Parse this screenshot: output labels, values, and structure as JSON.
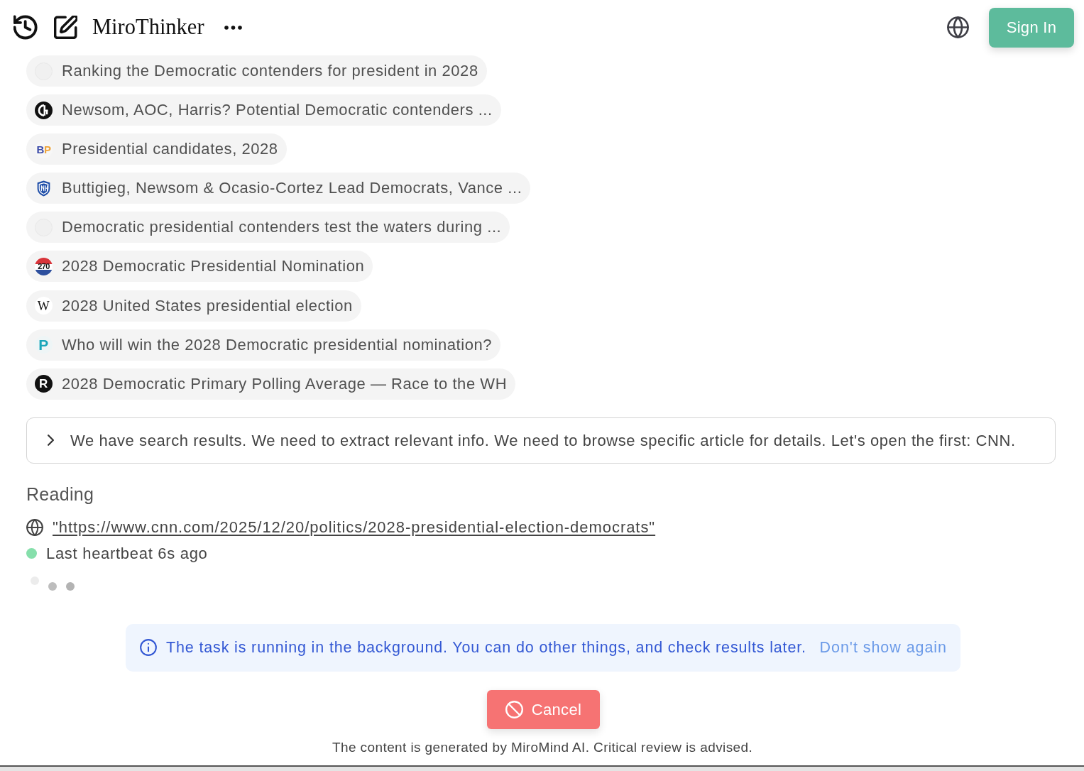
{
  "header": {
    "title": "MiroThinker",
    "sign_in": "Sign In"
  },
  "sources": [
    {
      "title": "Ranking the Democratic contenders for president in 2028",
      "favicon": {
        "kind": "blank"
      }
    },
    {
      "title": "Newsom, AOC, Harris? Potential Democratic contenders ...",
      "favicon": {
        "kind": "g"
      }
    },
    {
      "title": "Presidential candidates, 2028",
      "favicon": {
        "kind": "pair",
        "text": "BP"
      }
    },
    {
      "title": "Buttigieg, Newsom & Ocasio-Cortez Lead Democrats, Vance ...",
      "favicon": {
        "kind": "shield"
      }
    },
    {
      "title": "Democratic presidential contenders test the waters during ...",
      "favicon": {
        "kind": "blank"
      }
    },
    {
      "title": "2028 Democratic Presidential Nomination",
      "favicon": {
        "kind": "ring",
        "text": "270"
      }
    },
    {
      "title": "2028 United States presidential election",
      "favicon": {
        "kind": "serif",
        "text": "W"
      }
    },
    {
      "title": "Who will win the 2028 Democratic presidential nomination?",
      "favicon": {
        "kind": "bold",
        "text": "P"
      }
    },
    {
      "title": "2028 Democratic Primary Polling Average — Race to the WH",
      "favicon": {
        "kind": "disc",
        "text": "R"
      }
    }
  ],
  "thought": {
    "expanded": false,
    "text": "We have search results. We need to extract relevant info. We need to browse specific article for details. Let's open the first: CNN."
  },
  "reading": {
    "heading": "Reading",
    "url": "\"https://www.cnn.com/2025/12/20/politics/2028-presidential-election-democrats\""
  },
  "heartbeat": {
    "active": true,
    "text": "Last heartbeat 6s ago"
  },
  "notice": {
    "text": "The task is running in the background. You can do other things, and check results later.",
    "dismiss": "Don't show again"
  },
  "cancel_button": "Cancel",
  "disclaimer": "The content is generated by MiroMind AI. Critical review is advised."
}
